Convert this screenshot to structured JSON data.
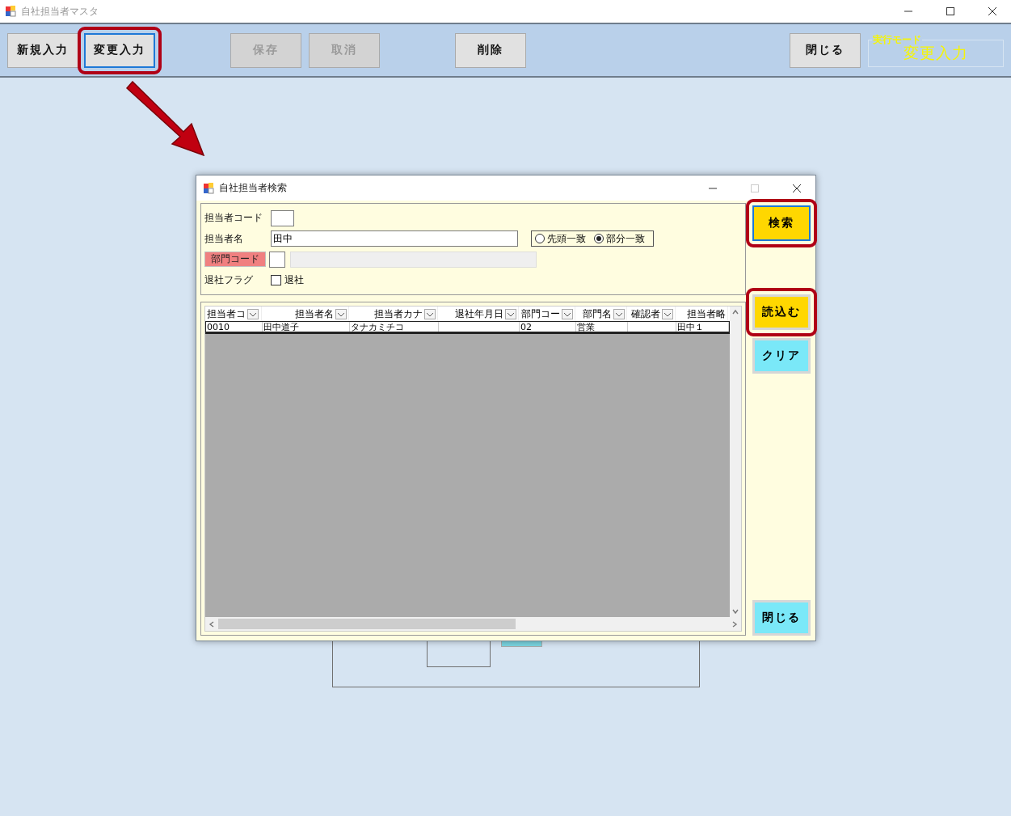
{
  "window": {
    "title": "自社担当者マスタ"
  },
  "toolbar": {
    "buttons": [
      {
        "label": "新規入力",
        "disabled": false,
        "focused": false,
        "highlighted": false
      },
      {
        "label": "変更入力",
        "disabled": false,
        "focused": true,
        "highlighted": true
      },
      {
        "label": "保存",
        "disabled": true,
        "focused": false,
        "highlighted": false
      },
      {
        "label": "取消",
        "disabled": true,
        "focused": false,
        "highlighted": false
      },
      {
        "label": "削除",
        "disabled": false,
        "focused": false,
        "highlighted": false
      },
      {
        "label": "閉じる",
        "disabled": false,
        "focused": false,
        "highlighted": false
      }
    ],
    "mode": {
      "label": "実行モード",
      "value": "変更入力"
    }
  },
  "dialog": {
    "title": "自社担当者検索",
    "fields": [
      {
        "kind": "text",
        "label": "担当者コード"
      },
      {
        "kind": "text_match",
        "label": "担当者名",
        "value": "田中",
        "options": [
          {
            "label": "先頭一致",
            "selected": false
          },
          {
            "label": "部分一致",
            "selected": true
          }
        ]
      },
      {
        "kind": "code_lookup",
        "label": "部門コード"
      },
      {
        "kind": "checkbox",
        "label": "退社フラグ",
        "option": "退社",
        "checked": false
      }
    ],
    "grid": {
      "columns": [
        "担当者コ",
        "担当者名",
        "担当者カナ",
        "退社年月日",
        "部門コー",
        "部門名",
        "確認者",
        "担当者略"
      ],
      "rows": [
        [
          "0010",
          "田中道子",
          "タナカミチコ",
          "",
          "02",
          "営業",
          "",
          "田中１"
        ]
      ]
    },
    "buttons": [
      {
        "label": "検索",
        "color": "#ffd700",
        "highlighted": true,
        "focused": true
      },
      {
        "label": "読込む",
        "color": "#ffd700",
        "highlighted": true,
        "focused": false
      },
      {
        "label": "クリア",
        "color": "#7ae8f8",
        "highlighted": false,
        "focused": false
      },
      {
        "label": "閉じる",
        "color": "#7ae8f8",
        "highlighted": false,
        "focused": false
      }
    ]
  }
}
